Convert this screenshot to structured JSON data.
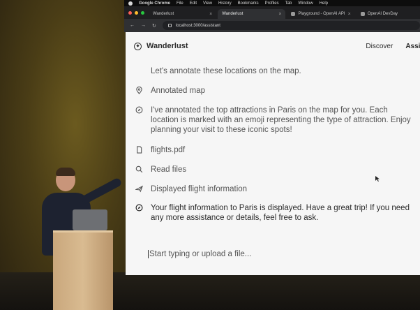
{
  "menubar": {
    "app": "Google Chrome",
    "items": [
      "File",
      "Edit",
      "View",
      "History",
      "Bookmarks",
      "Profiles",
      "Tab",
      "Window",
      "Help"
    ]
  },
  "tabs": [
    {
      "label": "Wanderlust",
      "active": false
    },
    {
      "label": "Wanderlust",
      "active": true
    },
    {
      "label": "Playground - OpenAI API",
      "active": false
    },
    {
      "label": "OpenAI DevDay",
      "active": false
    }
  ],
  "address": {
    "url": "localhost:3000/assistant"
  },
  "header": {
    "brand": "Wanderlust",
    "nav": [
      "Discover",
      "Assis"
    ]
  },
  "messages": [
    {
      "icon": "none",
      "text": "Let's annotate these locations on the map.",
      "style": "plain"
    },
    {
      "icon": "map-pin-icon",
      "text": "Annotated map",
      "style": "plain"
    },
    {
      "icon": "assistant-compass-icon",
      "text": "I've annotated the top attractions in Paris on the map for you. Each location is marked with an emoji representing the type of attraction. Enjoy planning your visit to these iconic spots!",
      "style": "plain"
    },
    {
      "icon": "file-icon",
      "text": "flights.pdf",
      "style": "plain"
    },
    {
      "icon": "search-icon",
      "text": "Read files",
      "style": "plain"
    },
    {
      "icon": "airplane-icon",
      "text": "Displayed flight information",
      "style": "plain"
    },
    {
      "icon": "assistant-compass-icon",
      "text": "Your flight information to Paris is displayed. Have a great trip! If you need any more assistance or details, feel free to ask.",
      "style": "dark"
    }
  ],
  "composer": {
    "placeholder": "Start typing or upload a file..."
  },
  "colors": {
    "page_bg": "#f6f6f6",
    "chrome_dark": "#1f1f21",
    "wall": "#4a3d16",
    "podium": "#d9bb91"
  }
}
